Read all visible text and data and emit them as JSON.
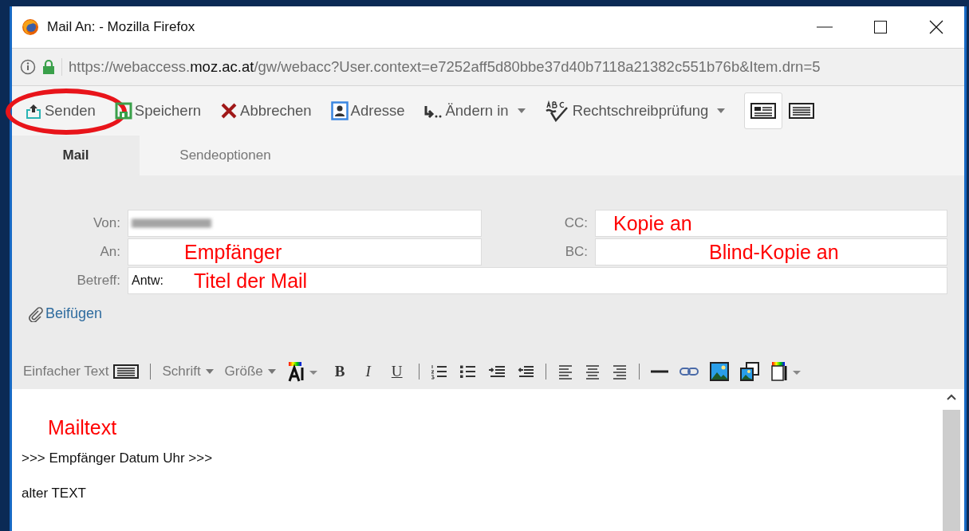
{
  "window": {
    "title": "Mail An: - Mozilla Firefox"
  },
  "address_bar": {
    "url": "https://webaccess.**moz.ac.at**/gw/webacc?User.context=e7252aff5d80bbe37d40b7118a21382c551b76b&Item.drn=5"
  },
  "toolbar": {
    "buttons": [
      {
        "label": "Senden",
        "dropdown": false,
        "circled": true
      },
      {
        "label": "Speichern",
        "dropdown": false,
        "circled": false
      },
      {
        "label": "Abbrechen",
        "dropdown": false,
        "circled": false
      },
      {
        "label": "Adresse",
        "dropdown": false,
        "circled": false
      },
      {
        "label": "Ändern in",
        "dropdown": true,
        "circled": false
      },
      {
        "label": "Rechtschreibprüfung",
        "dropdown": true,
        "circled": false
      }
    ],
    "view_buttons": [
      {
        "selected": true
      },
      {
        "selected": false
      }
    ]
  },
  "tabs": [
    {
      "label": "Mail",
      "selected": true
    },
    {
      "label": "Sendeoptionen",
      "selected": false
    }
  ],
  "form": {
    "von": {
      "label": "Von:",
      "redacted": true
    },
    "an": {
      "label": "An:",
      "annotation": "Empfänger"
    },
    "betreff": {
      "label": "Betreff:",
      "value": "Antw:",
      "annotation": "Titel der Mail"
    },
    "cc": {
      "label": "CC:",
      "annotation": "Kopie an"
    },
    "bc": {
      "label": "BC:",
      "annotation": "Blind-Kopie an"
    },
    "attach": "Beifügen"
  },
  "format_toolbar": {
    "mode": "Einfacher Text",
    "menus": [
      "Schrift",
      "Größe"
    ],
    "letters": [
      "B",
      "I",
      "U"
    ]
  },
  "editor": {
    "annotation": "Mailtext",
    "lines": [
      ">>> Empfänger Datum Uhr >>>",
      "alter TEXT"
    ]
  }
}
